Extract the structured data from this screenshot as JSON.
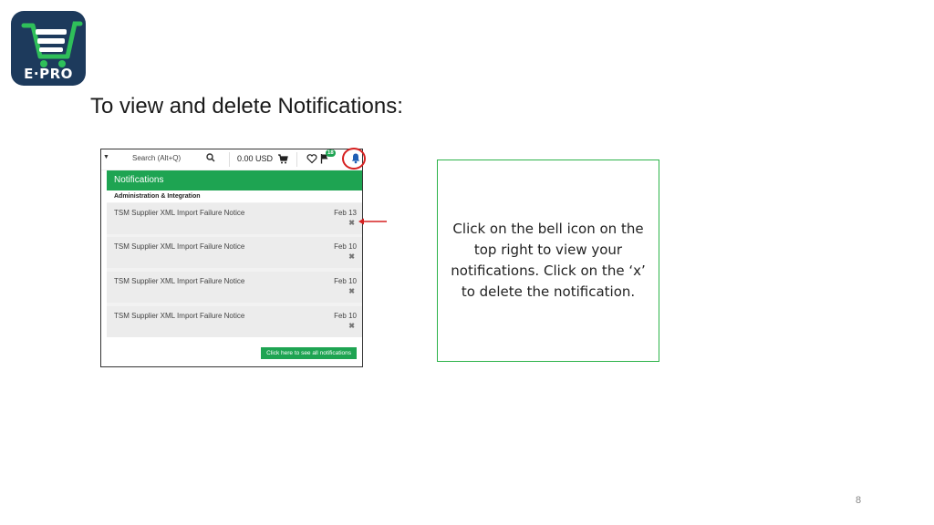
{
  "logo": {
    "text": "E·PRO"
  },
  "slide": {
    "title": "To view and delete Notifications:",
    "page_number": "8"
  },
  "topbar": {
    "search_placeholder": "Search (Alt+Q)",
    "amount": "0.00 USD",
    "badge_count": "18",
    "icons": [
      "caret-down-icon",
      "search-icon",
      "cart-icon",
      "heart-icon",
      "flag-icon",
      "bell-icon"
    ]
  },
  "notifications": {
    "header": "Notifications",
    "category": "Administration & Integration",
    "items": [
      {
        "text": "TSM Supplier XML Import Failure Notice",
        "date": "Feb 13",
        "delete": "✖"
      },
      {
        "text": "TSM Supplier XML Import Failure Notice",
        "date": "Feb 10",
        "delete": "✖"
      },
      {
        "text": "TSM Supplier XML Import Failure Notice",
        "date": "Feb 10",
        "delete": "✖"
      },
      {
        "text": "TSM Supplier XML Import Failure Notice",
        "date": "Feb 10",
        "delete": "✖"
      }
    ],
    "see_all": "Click here to see all notifications"
  },
  "callout": {
    "text": "Click on the bell icon on the top right to view your notifications. Click on the ‘x’ to delete the notification."
  },
  "colors": {
    "accent_green": "#1ea452",
    "highlight_red": "#d62020",
    "logo_bg": "#1d3a5c"
  }
}
